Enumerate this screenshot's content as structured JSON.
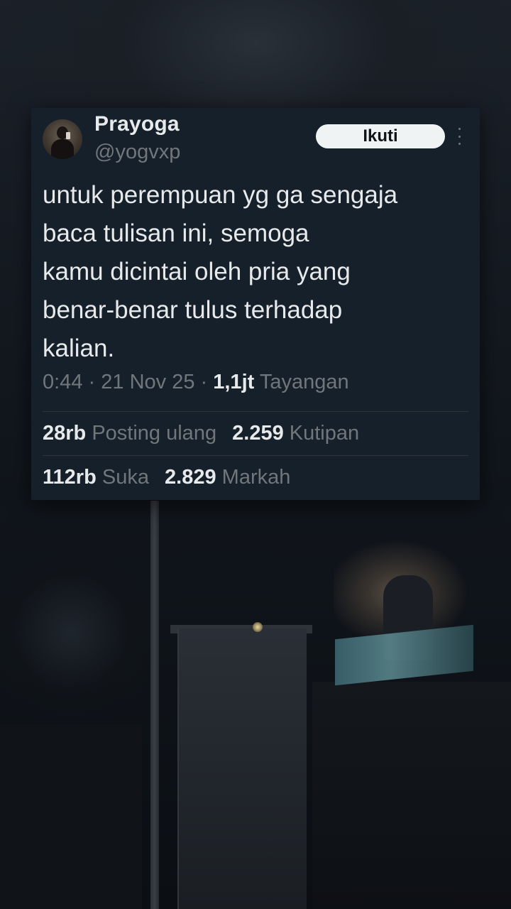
{
  "author": {
    "display_name": "Prayoga",
    "username": "@yogvxp",
    "avatar_icon": "profile-photo"
  },
  "follow_button": {
    "label": "Ikuti"
  },
  "more_icon": "more-vertical-icon",
  "tweet": {
    "text": "untuk perempuan yg ga sengaja\nbaca tulisan ini, semoga\nkamu dicintai oleh pria yang\nbenar-benar tulus terhadap\nkalian."
  },
  "meta": {
    "time": "0:44",
    "separator": "·",
    "date": "21 Nov 25",
    "views_count": "1,1jt",
    "views_label": "Tayangan"
  },
  "stats": {
    "reposts": {
      "count": "28rb",
      "label": "Posting ulang"
    },
    "quotes": {
      "count": "2.259",
      "label": "Kutipan"
    },
    "likes": {
      "count": "112rb",
      "label": "Suka"
    },
    "bookmarks": {
      "count": "2.829",
      "label": "Markah"
    }
  },
  "colors": {
    "card_bg": "#15202b",
    "primary_text": "#e7e9ea",
    "secondary_text": "#71767b",
    "button_bg": "#eff3f4",
    "divider": "#2f3336"
  }
}
